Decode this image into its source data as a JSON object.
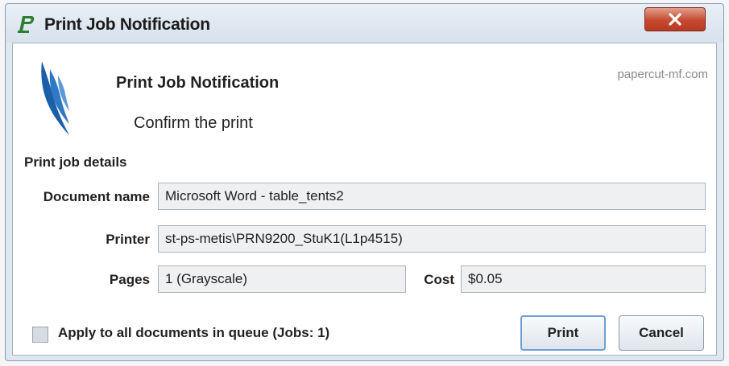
{
  "window": {
    "title": "Print Job Notification",
    "close_label": "×"
  },
  "header": {
    "brand": "papercut-mf.com",
    "heading": "Print Job Notification",
    "subheading": "Confirm the print"
  },
  "details": {
    "section_label": "Print job details",
    "document_name_label": "Document name",
    "document_name_value": "Microsoft Word - table_tents2",
    "printer_label": "Printer",
    "printer_value": "st-ps-metis\\PRN9200_StuK1(L1p4515)",
    "pages_label": "Pages",
    "pages_value": "1  (Grayscale)",
    "cost_label": "Cost",
    "cost_value": "$0.05"
  },
  "footer": {
    "apply_all_label": "Apply to all documents in queue (Jobs: 1)",
    "print_button": "Print",
    "cancel_button": "Cancel"
  },
  "icons": {
    "app": "papercut-p-icon",
    "logo": "papercut-feather-logo",
    "close": "close-x-icon"
  },
  "colors": {
    "close_red": "#c5492f",
    "logo_blue": "#1a5fa8",
    "app_green": "#2e7d32"
  }
}
